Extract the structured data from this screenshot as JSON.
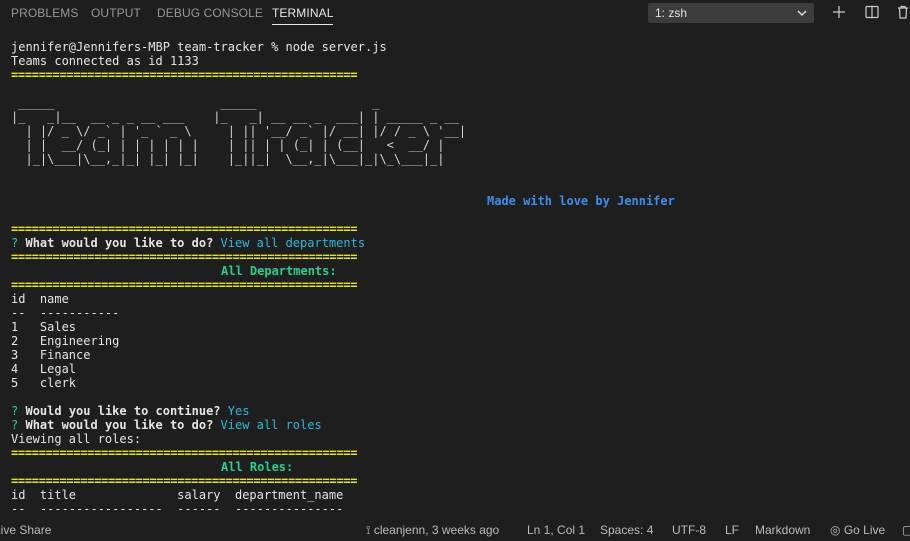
{
  "panel": {
    "tabs": [
      {
        "label": "PROBLEMS"
      },
      {
        "label": "OUTPUT"
      },
      {
        "label": "DEBUG CONSOLE"
      },
      {
        "label": "TERMINAL"
      }
    ],
    "shell_select": "1: zsh",
    "icons": [
      "add-terminal-icon",
      "split-terminal-icon",
      "trash-icon"
    ]
  },
  "terminal": {
    "prompt": "jennifer@Jennifers-MBP team-tracker % node server.js",
    "connected": "Teams connected as id 1133",
    "separator": "==================================================",
    "ascii_art": [
      " _____                       _____                _",
      "|_   _|__  __ _ _ __ ___    |_   _| __ __ _  ___| | _____ _ __",
      "  | |/ _ \\/ _` | '_ ` _ \\     | || '__/ _` |/ __| |/ / _ \\ '__|",
      "  | |  __/ (_| | | | | | |    | || | | (_| | (__|   <  __/ |",
      "  |_|\\___|\\__,_|_| |_| |_|    |_||_|  \\__,_|\\___|_|\\_\\___|_|"
    ],
    "made_with": "Made with love by Jennifer",
    "q1_mark": "?",
    "q1_text": "What would you like to do?",
    "q1_answer": "View all departments",
    "departments_title": "All Departments:",
    "dept_header": "id  name",
    "dept_rule": "--  -----------",
    "departments": [
      "1   Sales",
      "2   Engineering",
      "3   Finance",
      "4   Legal",
      "5   clerk"
    ],
    "q2_mark": "?",
    "q2_text": "Would you like to continue?",
    "q2_answer": "Yes",
    "q3_mark": "?",
    "q3_text": "What would you like to do?",
    "q3_answer": "View all roles",
    "viewing_roles": "Viewing all roles:",
    "roles_title": "All Roles:",
    "roles_header": "id  title              salary  department_name",
    "roles_rule": "--  -----------------  ------  ---------------"
  },
  "statusbar": {
    "left": "Live Share",
    "branch": "cleanjenn, 3 weeks ago",
    "position": "Ln 1, Col 1",
    "spaces": "Spaces: 4",
    "encoding": "UTF-8",
    "eol": "LF",
    "language": "Markdown",
    "go_live": "Go Live"
  }
}
